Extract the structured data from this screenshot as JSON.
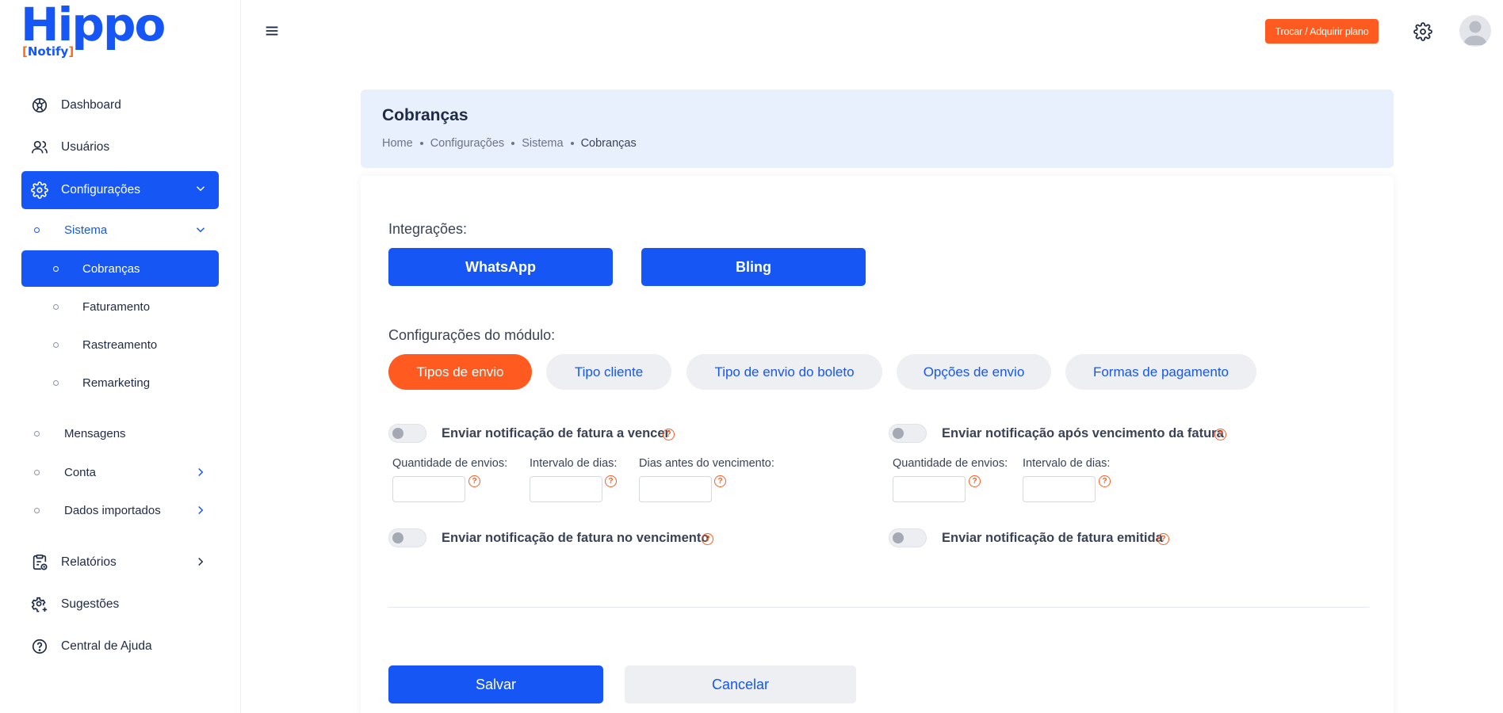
{
  "brand": {
    "logo_main": "Hippo",
    "logo_sub": "Notify",
    "primary_color": "#1556f5",
    "accent_color": "#ff5a1f"
  },
  "sidebar": {
    "items": [
      {
        "label": "Dashboard",
        "icon": "dashboard-icon"
      },
      {
        "label": "Usuários",
        "icon": "users-icon"
      },
      {
        "label": "Configurações",
        "icon": "gear-icon"
      },
      {
        "label": "Relatórios",
        "icon": "report-icon"
      },
      {
        "label": "Sugestões",
        "icon": "suggestions-icon"
      },
      {
        "label": "Central de Ajuda",
        "icon": "help-icon"
      }
    ],
    "sub": {
      "sistema": "Sistema",
      "cobrancas": "Cobranças",
      "faturamento": "Faturamento",
      "rastreamento": "Rastreamento",
      "remarketing": "Remarketing",
      "mensagens": "Mensagens",
      "conta": "Conta",
      "dados_importados": "Dados importados"
    }
  },
  "topbar": {
    "plan_button": "Trocar / Adquirir plano"
  },
  "header": {
    "title": "Cobranças",
    "breadcrumb": [
      "Home",
      "Configurações",
      "Sistema",
      "Cobranças"
    ]
  },
  "content": {
    "integrations_label": "Integrações:",
    "integrations": [
      "WhatsApp",
      "Bling"
    ],
    "module_label": "Configurações do módulo:",
    "tabs": [
      "Tipos de envio",
      "Tipo cliente",
      "Tipo de envio do boleto",
      "Opções de envio",
      "Formas de pagamento"
    ],
    "active_tab": "Tipos de envio",
    "notifications": {
      "a_vencer": {
        "label": "Enviar notificação de fatura a vencer",
        "enabled": false,
        "fields": [
          "Quantidade de envios:",
          "Intervalo de dias:",
          "Dias antes do vencimento:"
        ]
      },
      "apos_vencimento": {
        "label": "Enviar notificação após vencimento da fatura",
        "enabled": false,
        "fields": [
          "Quantidade de envios:",
          "Intervalo de dias:"
        ]
      },
      "no_vencimento": {
        "label": "Enviar notificação de fatura no vencimento",
        "enabled": false
      },
      "emitida": {
        "label": "Enviar notificação de fatura emitida",
        "enabled": false
      }
    },
    "help_glyph": "?",
    "save": "Salvar",
    "cancel": "Cancelar"
  }
}
